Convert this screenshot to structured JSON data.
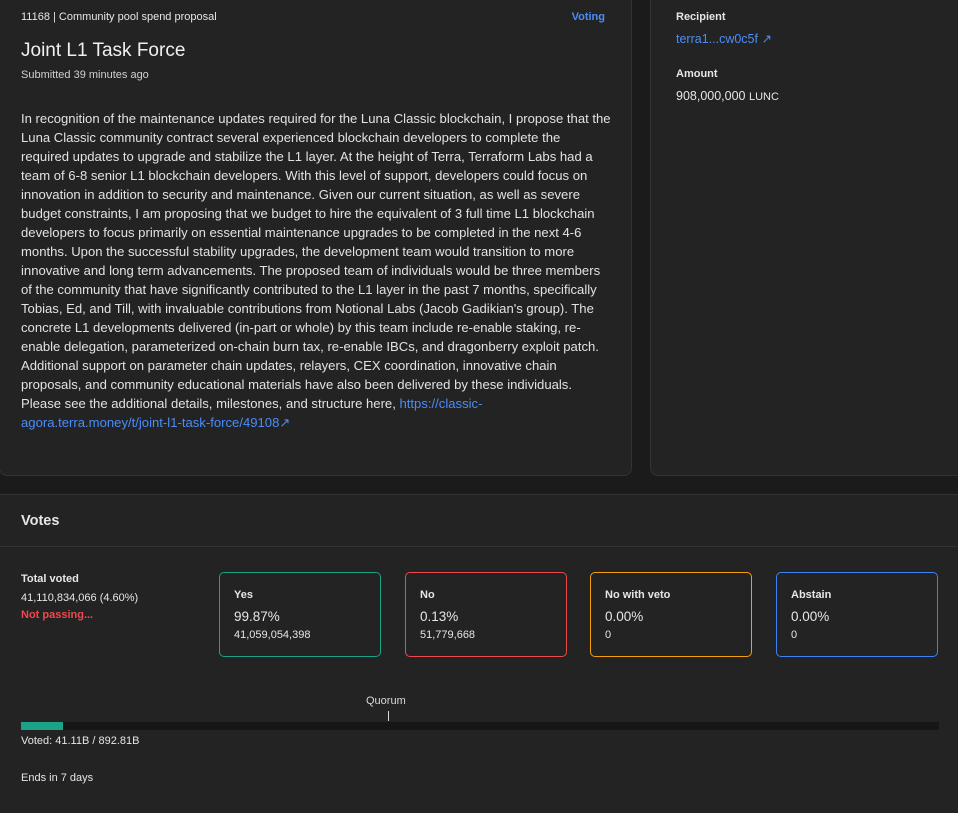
{
  "proposal": {
    "meta": "11168 | Community pool spend proposal",
    "status": "Voting",
    "title": "Joint L1 Task Force",
    "submitted": "Submitted 39 minutes ago",
    "description": "In recognition of the maintenance updates required for the Luna Classic blockchain, I propose that the Luna Classic community contract several experienced blockchain developers to complete the required updates to upgrade and stabilize the L1 layer. At the height of Terra, Terraform Labs had a team of 6-8 senior L1 blockchain developers. With this level of support, developers could focus on innovation in addition to security and maintenance. Given our current situation, as well as severe budget constraints, I am proposing that we budget to hire the equivalent of 3 full time L1 blockchain developers to focus primarily on essential maintenance upgrades to be completed in the next 4-6 months. Upon the successful stability upgrades, the development team would transition to more innovative and long term advancements. The proposed team of individuals would be three members of the community that have significantly contributed to the L1 layer in the past 7 months, specifically Tobias, Ed, and Till, with invaluable contributions from Notional Labs (Jacob Gadikian's group). The concrete L1 developments delivered (in-part or whole) by this team include re-enable staking, re-enable delegation, parameterized on-chain burn tax, re-enable IBCs, and dragonberry exploit patch. Additional support on parameter chain updates, relayers, CEX coordination, innovative chain proposals, and community educational materials have also been delivered by these individuals. Please see the additional details, milestones, and structure here,",
    "link": "https://classic-agora.terra.money/t/joint-l1-task-force/49108",
    "link_icon": "↗"
  },
  "side": {
    "recipient_label": "Recipient",
    "recipient_value": "terra1...cw0c5f",
    "recipient_icon": "↗",
    "amount_label": "Amount",
    "amount_value": "908,000,000",
    "amount_unit": "LUNC"
  },
  "votes": {
    "header": "Votes",
    "total_label": "Total voted",
    "total_value": "41,110,834,066 (4.60%)",
    "total_status": "Not passing...",
    "options": [
      {
        "title": "Yes",
        "percent": "99.87%",
        "count": "41,059,054,398",
        "color": "#1aa388"
      },
      {
        "title": "No",
        "percent": "0.13%",
        "count": "51,779,668",
        "color": "#f0484c"
      },
      {
        "title": "No with veto",
        "percent": "0.00%",
        "count": "0",
        "color": "#f59e0b"
      },
      {
        "title": "Abstain",
        "percent": "0.00%",
        "count": "0",
        "color": "#3b82f6"
      }
    ],
    "quorum_label": "Quorum",
    "voted_text": "Voted: 41.11B / 892.81B",
    "voted_fraction": 0.046,
    "ends_text": "Ends in 7 days"
  }
}
